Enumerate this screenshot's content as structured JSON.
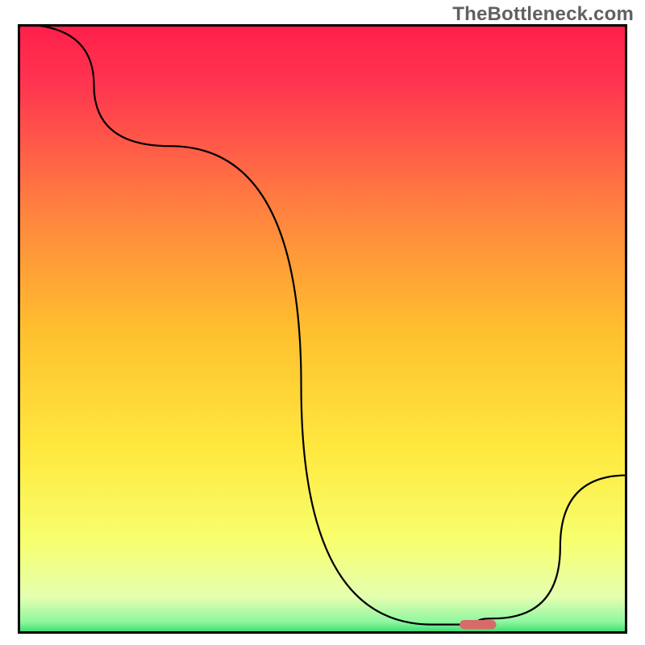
{
  "watermark": "TheBottleneck.com",
  "chart_data": {
    "type": "line",
    "title": "",
    "xlabel": "",
    "ylabel": "",
    "xlim": [
      0,
      100
    ],
    "ylim": [
      0,
      100
    ],
    "x": [
      0,
      25,
      68,
      73,
      78,
      100
    ],
    "values": [
      100,
      80,
      1.5,
      1.5,
      2.5,
      26
    ],
    "marker": {
      "x": 75.5,
      "y": 1.5,
      "width": 6,
      "height": 1.5,
      "color": "#d86a6a"
    },
    "gradient_stops": [
      {
        "offset": 0.0,
        "color": "#ff1f4b"
      },
      {
        "offset": 0.1,
        "color": "#ff3550"
      },
      {
        "offset": 0.3,
        "color": "#ff8040"
      },
      {
        "offset": 0.5,
        "color": "#ffbf2e"
      },
      {
        "offset": 0.7,
        "color": "#ffe93f"
      },
      {
        "offset": 0.85,
        "color": "#f7ff70"
      },
      {
        "offset": 0.94,
        "color": "#e4ffb0"
      },
      {
        "offset": 0.98,
        "color": "#90f7a0"
      },
      {
        "offset": 1.0,
        "color": "#2fd86a"
      }
    ]
  }
}
